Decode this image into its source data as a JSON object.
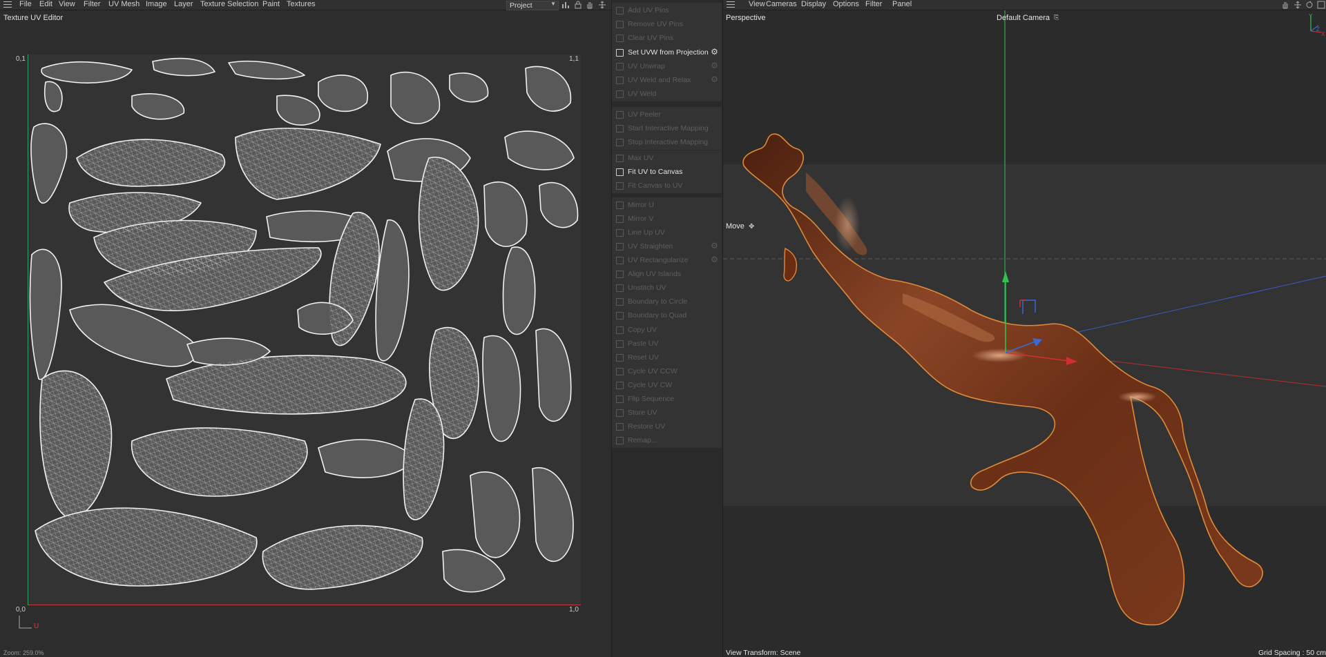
{
  "uv_menu": {
    "items": [
      "File",
      "Edit",
      "View",
      "Filter",
      "UV Mesh",
      "Image",
      "Layer",
      "Texture Selection",
      "Paint",
      "Textures"
    ],
    "project_select": "Project"
  },
  "viewport_menu": {
    "items": [
      "View",
      "Cameras",
      "Display",
      "Options",
      "Filter",
      "Panel"
    ]
  },
  "uv_editor": {
    "title": "Texture UV Editor",
    "corner_tl": "0,1",
    "corner_tr": "1,1",
    "corner_bl": "0,0",
    "corner_br": "1,0",
    "axis_u": "U",
    "zoom": "Zoom: 259.0%"
  },
  "tools": {
    "groups": [
      {
        "items": [
          {
            "label": "Add UV Pins",
            "active": false,
            "gear": false
          },
          {
            "label": "Remove UV Pins",
            "active": false,
            "gear": false
          },
          {
            "label": "Clear UV Pins",
            "active": false,
            "gear": false
          }
        ]
      },
      {
        "items": [
          {
            "label": "Set UVW from Projection",
            "active": true,
            "gear": true
          },
          {
            "label": "UV Unwrap",
            "active": false,
            "gear": true
          },
          {
            "label": "UV Weld and Relax",
            "active": false,
            "gear": true
          },
          {
            "label": "UV Weld",
            "active": false,
            "gear": false
          }
        ]
      },
      {
        "items": [
          {
            "label": "UV Peeler",
            "active": false,
            "gear": false
          },
          {
            "label": "Start Interactive Mapping",
            "active": false,
            "gear": false
          },
          {
            "label": "Stop Interactive Mapping",
            "active": false,
            "gear": false
          }
        ]
      },
      {
        "items": [
          {
            "label": "Max UV",
            "active": false,
            "gear": false
          },
          {
            "label": "Fit UV to Canvas",
            "active": true,
            "gear": false
          },
          {
            "label": "Fit Canvas to UV",
            "active": false,
            "gear": false
          }
        ]
      },
      {
        "items": [
          {
            "label": "Mirror U",
            "active": false,
            "gear": false
          },
          {
            "label": "Mirror V",
            "active": false,
            "gear": false
          },
          {
            "label": "Line Up UV",
            "active": false,
            "gear": false
          },
          {
            "label": "UV Straighten",
            "active": false,
            "gear": true
          },
          {
            "label": "UV Rectangularize",
            "active": false,
            "gear": true
          },
          {
            "label": "Align UV Islands",
            "active": false,
            "gear": false
          },
          {
            "label": "Unstitch UV",
            "active": false,
            "gear": false
          },
          {
            "label": "Boundary to Circle",
            "active": false,
            "gear": false
          },
          {
            "label": "Boundary to Quad",
            "active": false,
            "gear": false
          }
        ]
      },
      {
        "items": [
          {
            "label": "Copy UV",
            "active": false,
            "gear": false
          },
          {
            "label": "Paste UV",
            "active": false,
            "gear": false
          },
          {
            "label": "Reset UV",
            "active": false,
            "gear": false
          },
          {
            "label": "Cycle UV CCW",
            "active": false,
            "gear": false
          },
          {
            "label": "Cycle UV CW",
            "active": false,
            "gear": false
          },
          {
            "label": "Flip Sequence",
            "active": false,
            "gear": false
          },
          {
            "label": "Store UV",
            "active": false,
            "gear": false
          },
          {
            "label": "Restore UV",
            "active": false,
            "gear": false
          },
          {
            "label": "Remap...",
            "active": false,
            "gear": false
          }
        ]
      }
    ]
  },
  "viewport": {
    "view_name": "Perspective",
    "camera": "Default Camera",
    "tool": "Move",
    "view_transform": "View Transform: Scene",
    "grid_spacing": "Grid Spacing : 50 cm",
    "gizmo_axes": {
      "y": "Y",
      "z": "Z",
      "x": "X"
    }
  },
  "colors": {
    "chocolate": "#7a3a1e",
    "selection_outline": "#e08a3a",
    "axis_x": "#d03030",
    "axis_y": "#30c050",
    "axis_z": "#3a6ad8"
  }
}
